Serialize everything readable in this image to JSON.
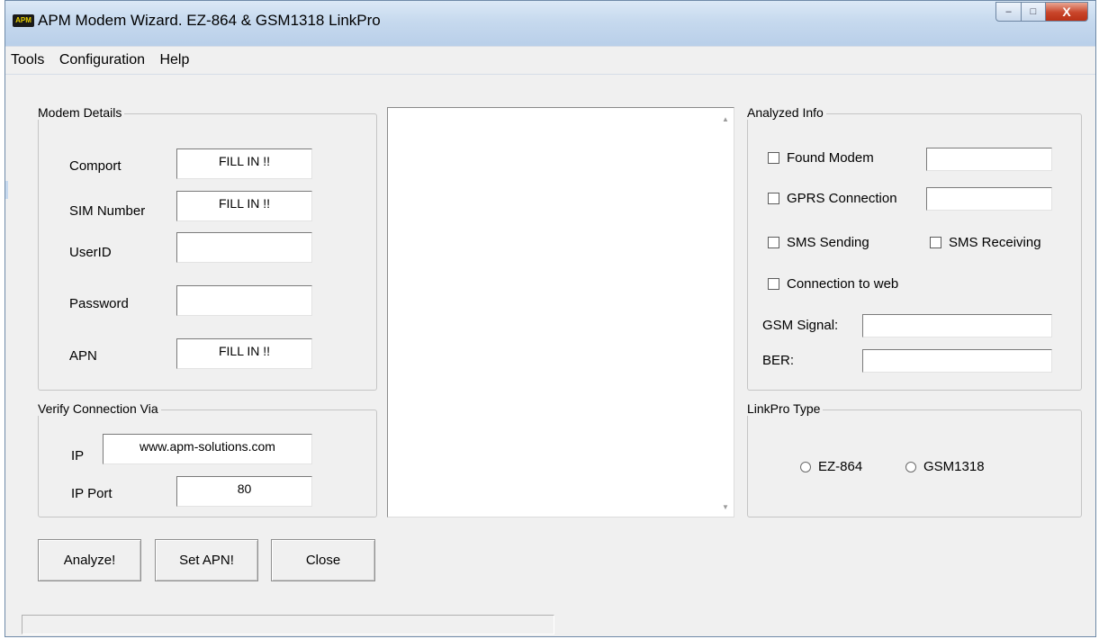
{
  "window": {
    "title": "APM Modem Wizard. EZ-864 & GSM1318 LinkPro",
    "icon_text": "APM",
    "buttons": {
      "minimize": "–",
      "maximize": "□",
      "close": "X"
    }
  },
  "menu": [
    "Tools",
    "Configuration",
    "Help"
  ],
  "modem_details": {
    "title": "Modem Details",
    "comport": {
      "label": "Comport",
      "value": "FILL IN !!"
    },
    "sim_number": {
      "label": "SIM Number",
      "value": "FILL IN !!"
    },
    "userid": {
      "label": "UserID",
      "value": ""
    },
    "password": {
      "label": "Password",
      "value": ""
    },
    "apn": {
      "label": "APN",
      "value": "FILL IN !!"
    }
  },
  "verify": {
    "title": "Verify Connection Via",
    "ip": {
      "label": "IP",
      "value": "www.apm-solutions.com"
    },
    "ip_port": {
      "label": "IP Port",
      "value": "80"
    }
  },
  "output": {
    "text": ""
  },
  "analyzed": {
    "title": "Analyzed Info",
    "found_modem": {
      "label": "Found Modem",
      "checked": false,
      "value": ""
    },
    "gprs_connection": {
      "label": "GPRS Connection",
      "checked": false,
      "value": ""
    },
    "sms_sending": {
      "label": "SMS Sending",
      "checked": false
    },
    "sms_receiving": {
      "label": "SMS Receiving",
      "checked": false
    },
    "connection_web": {
      "label": "Connection to web",
      "checked": false
    },
    "gsm_signal": {
      "label": "GSM Signal:",
      "value": ""
    },
    "ber": {
      "label": "BER:",
      "value": ""
    }
  },
  "linkpro": {
    "title": "LinkPro Type",
    "options": [
      "EZ-864",
      "GSM1318"
    ],
    "selected": null
  },
  "buttons": {
    "analyze": "Analyze!",
    "set_apn": "Set APN!",
    "close": "Close"
  },
  "status": {
    "text": ""
  }
}
